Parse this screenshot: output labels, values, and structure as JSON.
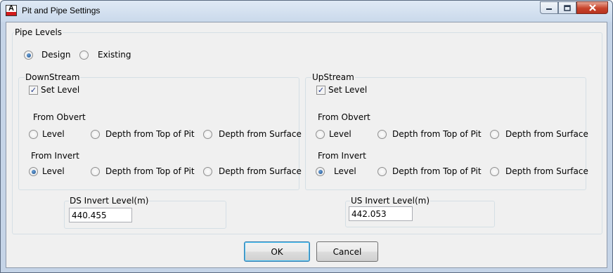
{
  "window": {
    "title": "Pit and Pipe Settings"
  },
  "pipe_levels": {
    "label": "Pipe Levels",
    "options": [
      {
        "label": "Design",
        "selected": true
      },
      {
        "label": "Existing",
        "selected": false
      }
    ]
  },
  "downstream": {
    "title": "DownStream",
    "set_level_label": "Set Level",
    "set_level_checked": true,
    "from_obvert": {
      "label": "From Obvert",
      "options": [
        "Level",
        "Depth from Top of Pit",
        "Depth from Surface"
      ],
      "selected_index": null
    },
    "from_invert": {
      "label": "From Invert",
      "options": [
        "Level",
        "Depth from Top of Pit",
        "Depth from Surface"
      ],
      "selected_index": 0
    },
    "invert_level": {
      "label": "DS Invert Level(m)",
      "value": "440.455"
    }
  },
  "upstream": {
    "title": "UpStream",
    "set_level_label": "Set Level",
    "set_level_checked": true,
    "from_obvert": {
      "label": "From Obvert",
      "options": [
        "Level",
        "Depth from Top of Pit",
        "Depth from Surface"
      ],
      "selected_index": null
    },
    "from_invert": {
      "label": "From Invert",
      "options": [
        "Level",
        "Depth from Top of Pit",
        "Depth from Surface"
      ],
      "selected_index": 0
    },
    "invert_level": {
      "label": "US Invert Level(m)",
      "value": "442.053"
    }
  },
  "buttons": {
    "ok": "OK",
    "cancel": "Cancel"
  }
}
